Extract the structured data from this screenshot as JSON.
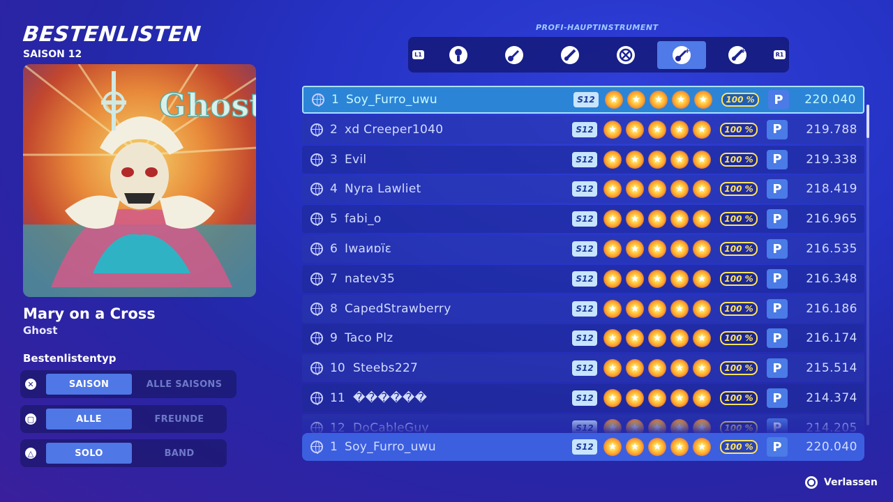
{
  "header": {
    "title": "BESTENLISTEN",
    "season": "SAISON 12"
  },
  "song": {
    "title": "Mary on a Cross",
    "artist": "Ghost",
    "cover_text": "Ghost"
  },
  "leaderboard_type": {
    "label": "Bestenlistentyp",
    "toggles": [
      {
        "button_icon": "cross-button-icon",
        "glyph": "✕",
        "active": "SAISON",
        "inactive": "ALLE SAISONS"
      },
      {
        "button_icon": "square-button-icon",
        "glyph": "▢",
        "active": "ALLE",
        "inactive": "FREUNDE"
      },
      {
        "button_icon": "triangle-button-icon",
        "glyph": "△",
        "active": "SOLO",
        "inactive": "BAND"
      }
    ]
  },
  "instruments": {
    "label": "PROFI-HAUPTINSTRUMENT",
    "left_shoulder": "L1",
    "right_shoulder": "R1",
    "items": [
      {
        "icon": "microphone-icon",
        "selected": false
      },
      {
        "icon": "guitar-icon",
        "selected": false
      },
      {
        "icon": "bass-icon",
        "selected": false
      },
      {
        "icon": "drums-icon",
        "selected": false
      },
      {
        "icon": "pro-guitar-icon",
        "selected": true
      },
      {
        "icon": "pro-bass-icon",
        "selected": false
      }
    ]
  },
  "entries": [
    {
      "rank": "1",
      "name": "Soy_Furro_uwu",
      "season": "S12",
      "stars": 5,
      "percent": "100 %",
      "badge": "P",
      "score": "220.040"
    },
    {
      "rank": "2",
      "name": "xd Creeper1040",
      "season": "S12",
      "stars": 5,
      "percent": "100 %",
      "badge": "P",
      "score": "219.788"
    },
    {
      "rank": "3",
      "name": "Evil",
      "season": "S12",
      "stars": 5,
      "percent": "100 %",
      "badge": "P",
      "score": "219.338"
    },
    {
      "rank": "4",
      "name": "Nyra Lawliet",
      "season": "S12",
      "stars": 5,
      "percent": "100 %",
      "badge": "P",
      "score": "218.419"
    },
    {
      "rank": "5",
      "name": "fabi_o",
      "season": "S12",
      "stars": 5,
      "percent": "100 %",
      "badge": "P",
      "score": "216.965"
    },
    {
      "rank": "6",
      "name": "Iwaиɒїɛ",
      "season": "S12",
      "stars": 5,
      "percent": "100 %",
      "badge": "P",
      "score": "216.535"
    },
    {
      "rank": "7",
      "name": "natev35",
      "season": "S12",
      "stars": 5,
      "percent": "100 %",
      "badge": "P",
      "score": "216.348"
    },
    {
      "rank": "8",
      "name": "CapedStrawberry",
      "season": "S12",
      "stars": 5,
      "percent": "100 %",
      "badge": "P",
      "score": "216.186"
    },
    {
      "rank": "9",
      "name": "Taco Plz",
      "season": "S12",
      "stars": 5,
      "percent": "100 %",
      "badge": "P",
      "score": "216.174"
    },
    {
      "rank": "10",
      "name": "Steebs227",
      "season": "S12",
      "stars": 5,
      "percent": "100 %",
      "badge": "P",
      "score": "215.514"
    },
    {
      "rank": "11",
      "name": "������",
      "season": "S12",
      "stars": 5,
      "percent": "100 %",
      "badge": "P",
      "score": "214.374"
    },
    {
      "rank": "12",
      "name": "DoCableGuy",
      "season": "S12",
      "stars": 5,
      "percent": "100 %",
      "badge": "P",
      "score": "214.205"
    }
  ],
  "player_entry": {
    "rank": "1",
    "name": "Soy_Furro_uwu",
    "season": "S12",
    "stars": 5,
    "percent": "100 %",
    "badge": "P",
    "score": "220.040"
  },
  "footer": {
    "exit_label": "Verlassen",
    "exit_icon": "circle-button-icon"
  },
  "colors": {
    "accent": "#4f77e6",
    "highlight_row": "#2c84d6",
    "player_row": "#3c5fe0",
    "percent": "#ffe35c"
  }
}
